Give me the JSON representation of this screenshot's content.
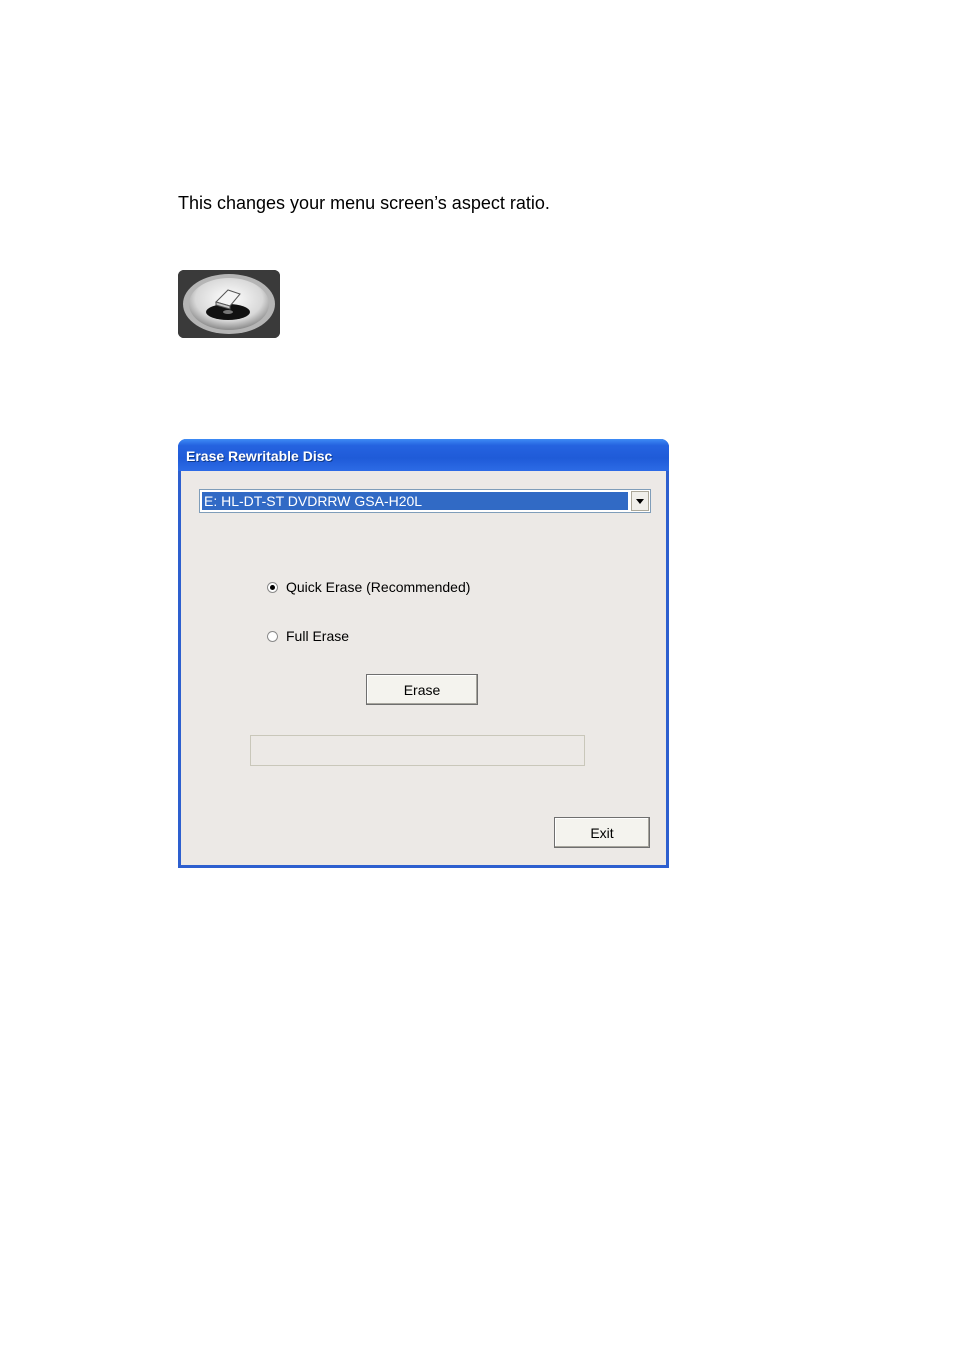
{
  "intro_text": "This changes your menu screen’s aspect ratio.",
  "icon": {
    "name": "disc-eraser-icon"
  },
  "dialog": {
    "title": "Erase Rewritable Disc",
    "drive_select": {
      "value": "E: HL-DT-ST DVDRRW GSA-H20L"
    },
    "options": [
      {
        "label": "Quick Erase (Recommended)",
        "selected": true
      },
      {
        "label": "Full Erase",
        "selected": false
      }
    ],
    "erase_label": "Erase",
    "progress": 0,
    "exit_label": "Exit",
    "colors": {
      "title_bar": "#2563e0",
      "selection": "#316ac5",
      "face": "#ece9e6"
    }
  }
}
